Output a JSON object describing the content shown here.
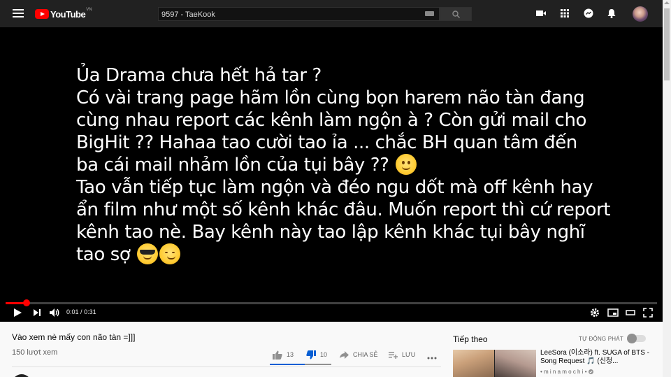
{
  "header": {
    "logo_text": "YouTube",
    "logo_region": "VN",
    "search_value": "9597 - TaeKook",
    "icons": [
      "menu-icon",
      "keyboard-icon",
      "search-icon",
      "create-video-icon",
      "apps-icon",
      "messages-icon",
      "notifications-icon"
    ]
  },
  "video": {
    "caption_lines": [
      "Ủa Drama chưa hết hả tar ?",
      "Có vài trang page hãm lồn cùng bọn harem não tàn đang",
      "cùng nhau report các kênh làm ngộn à ? Còn gửi mail cho",
      "BigHit ?? Hahaa tao cười tao ỉa ... chắc BH quan tâm đến",
      "ba cái mail nhảm lồn của tụi bây ??",
      "Tao vẫn tiếp tục làm ngộn và đéo ngu dốt mà off kênh hay",
      "ẩn film như một số kênh khác đâu. Muốn report thì cứ report",
      "kênh tao nè. Bay kênh này tao lập kênh khác tụi bây nghĩ",
      "tao sợ"
    ],
    "emojis": [
      "slightly-smiling-face",
      "smiling-face-with-sunglasses",
      "smirking-face"
    ],
    "time_current": "0:01",
    "time_separator": "/",
    "time_total": "0:31",
    "progress_fraction": 0.032,
    "controls": [
      "play-icon",
      "next-icon",
      "volume-icon",
      "settings-icon",
      "miniplayer-icon",
      "theater-mode-icon",
      "fullscreen-icon"
    ]
  },
  "details": {
    "title": "Vào xem nè mấy con não tàn =]]]",
    "views": "150 lượt xem",
    "like_count": "13",
    "dislike_count": "10",
    "like_ratio": 0.565,
    "share_label": "CHIA SẺ",
    "save_label": "LƯU"
  },
  "sidebar": {
    "up_next_label": "Tiếp theo",
    "autoplay_label": "TỰ ĐỘNG PHÁT",
    "autoplay_on": false,
    "recommendation": {
      "title": "LeeSora (이소라) ft. SUGA of BTS - Song Request 🎵 (신청...",
      "channel": "• m i n a m o c h i •"
    }
  },
  "colors": {
    "accent_red": "#ff0000",
    "dislike_blue": "#065fd4",
    "masthead": "#212121"
  }
}
